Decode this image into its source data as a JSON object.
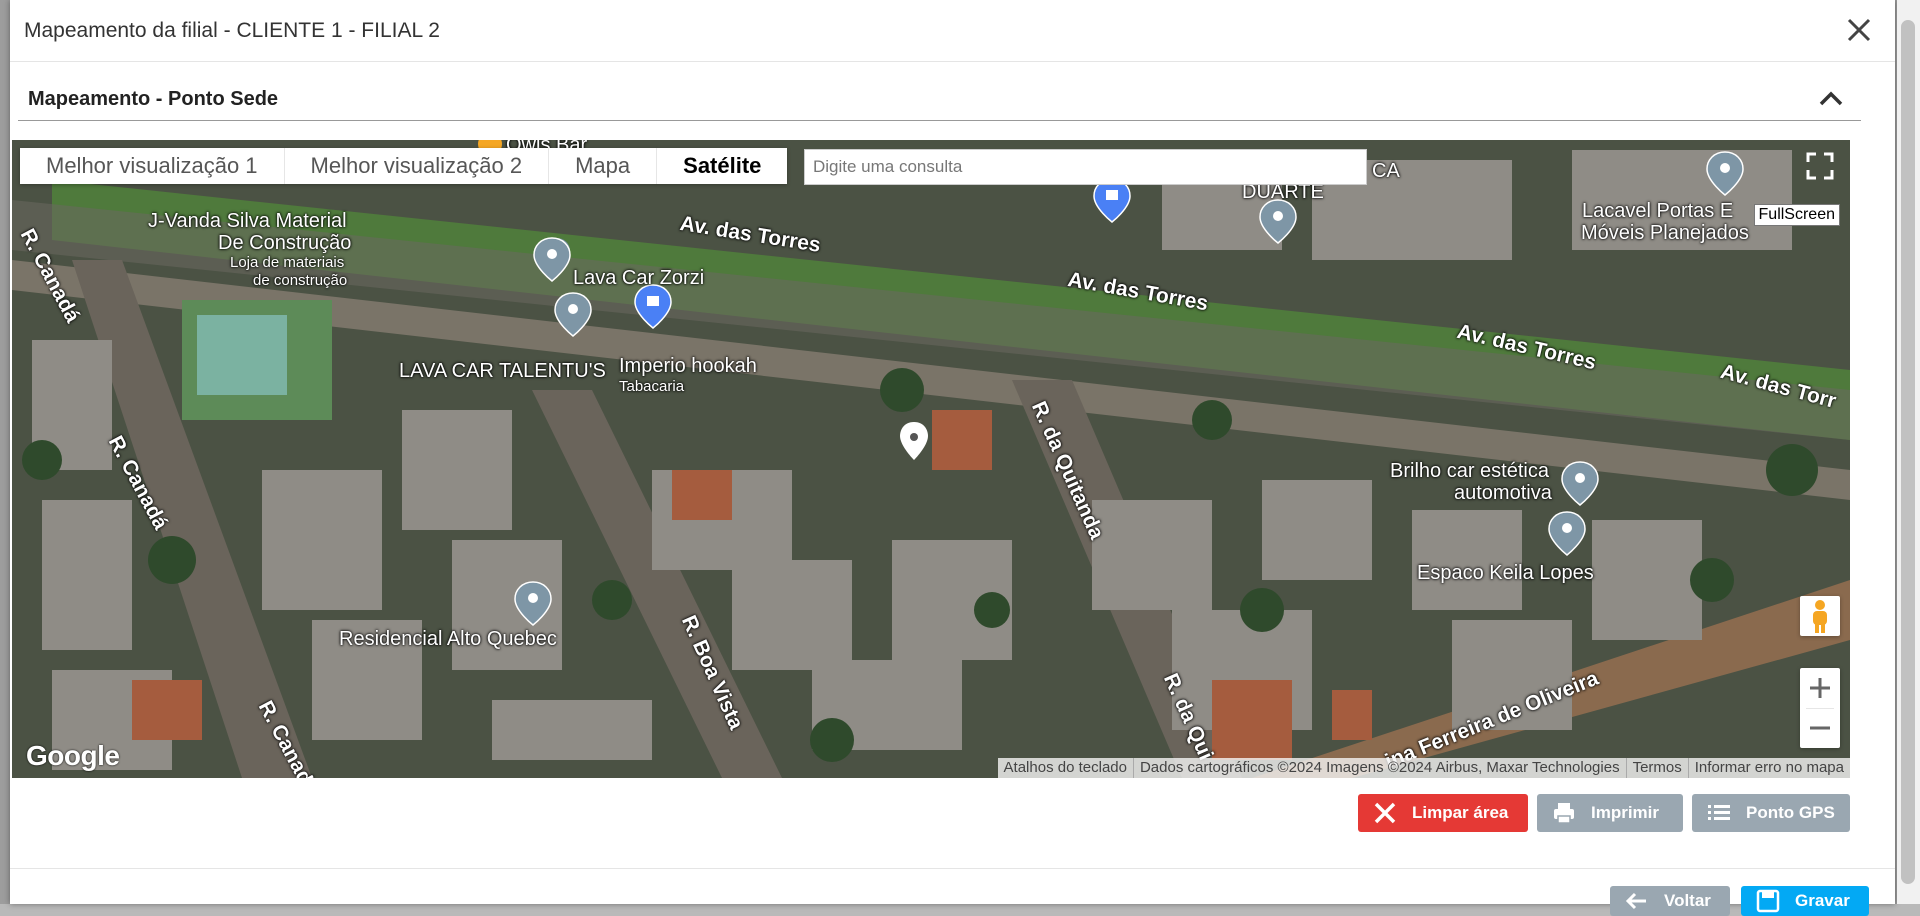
{
  "modal": {
    "title": "Mapeamento da filial - CLIENTE 1 - FILIAL 2",
    "section_title": "Mapeamento - Ponto Sede"
  },
  "map": {
    "type_tabs": [
      "Melhor visualização 1",
      "Melhor visualização 2",
      "Mapa",
      "Satélite"
    ],
    "active_tab": "Satélite",
    "search": {
      "value": "",
      "placeholder": "Digite uma consulta"
    },
    "fullscreen_label": "FullScreen",
    "logo": "Google",
    "attribution": [
      "Atalhos do teclado",
      "Dados cartográficos ©2024 Imagens ©2024 Airbus, Maxar Technologies",
      "Termos",
      "Informar erro no mapa"
    ],
    "place_labels": {
      "owls_bar": "Owls Bar",
      "vanda": "J-Vanda Silva Material",
      "vanda2": "De Construção",
      "vanda_cat": "Loja de materiais",
      "vanda_cat2": "de construção",
      "lava_zorzi": "Lava Car Zorzi",
      "talentus": "LAVA CAR TALENTU'S",
      "imperio": "Imperio hookah",
      "imperio_cat": "Tabacaria",
      "duarte": "DUARTE",
      "ca": "CA",
      "lacavel": "Lacavel Portas E",
      "lacavel2": "Móveis Planejados",
      "brilho": "Brilho car estética",
      "brilho2": "automotiva",
      "keila": "Espaco Keila Lopes",
      "residencial": "Residencial Alto Quebec"
    },
    "road_labels": {
      "torres1": "Av. das Torres",
      "torres2": "Av. das Torres",
      "torres3": "Av. das Torres",
      "torres4": "Av. das Torr",
      "canada1": "R. Canadá",
      "canada2": "R. Canadá",
      "canada3": "R. Canad",
      "quitanda1": "R. da Quitanda",
      "quitanda2": "R. da Qui",
      "boavista": "R. Boa Vista",
      "ferreira": "ina Ferreira de Oliveira"
    }
  },
  "actions": {
    "clear": "Limpar área",
    "print": "Imprimir",
    "gps": "Ponto GPS",
    "back": "Voltar",
    "save": "Gravar"
  },
  "colors": {
    "red": "#e53935",
    "gray": "#9aa7b1",
    "blue": "#03a9f4"
  }
}
